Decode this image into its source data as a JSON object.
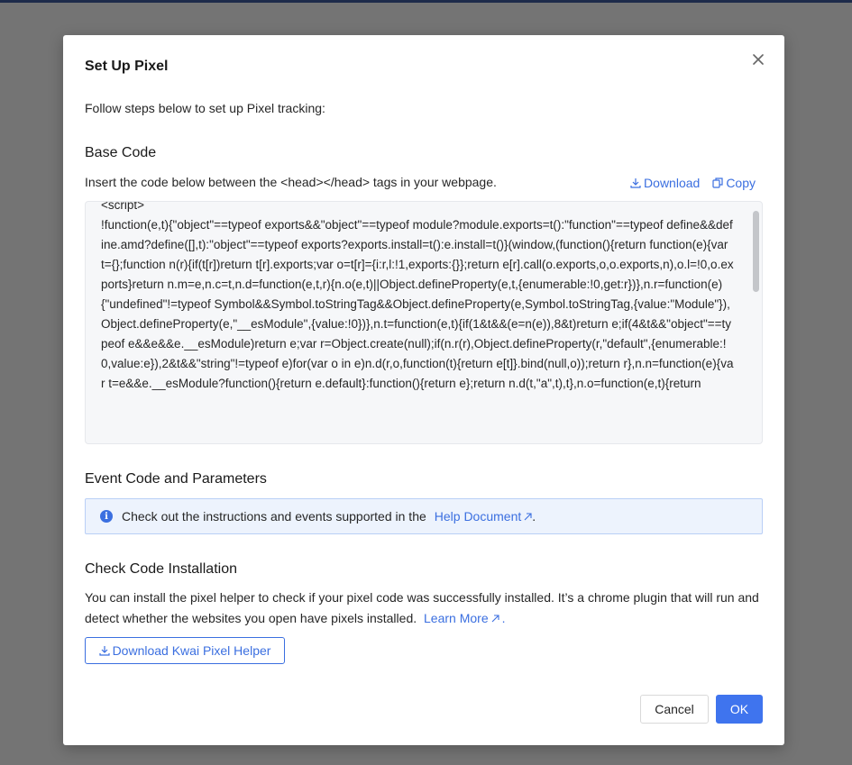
{
  "modal": {
    "title": "Set Up Pixel",
    "intro": "Follow steps below to set up Pixel tracking:"
  },
  "base_code": {
    "heading": "Base Code",
    "description": "Insert the code below between the <head></head> tags in your webpage.",
    "download_label": "Download",
    "copy_label": "Copy",
    "code": "<script>\n!function(e,t){\"object\"==typeof exports&&\"object\"==typeof module?module.exports=t():\"function\"==typeof define&&define.amd?define([],t):\"object\"==typeof exports?exports.install=t():e.install=t()}(window,(function(){return function(e){var t={};function n(r){if(t[r])return t[r].exports;var o=t[r]={i:r,l:!1,exports:{}};return e[r].call(o.exports,o,o.exports,n),o.l=!0,o.exports}return n.m=e,n.c=t,n.d=function(e,t,r){n.o(e,t)||Object.defineProperty(e,t,{enumerable:!0,get:r})},n.r=function(e){\"undefined\"!=typeof Symbol&&Symbol.toStringTag&&Object.defineProperty(e,Symbol.toStringTag,{value:\"Module\"}),Object.defineProperty(e,\"__esModule\",{value:!0})},n.t=function(e,t){if(1&t&&(e=n(e)),8&t)return e;if(4&t&&\"object\"==typeof e&&e&&e.__esModule)return e;var r=Object.create(null);if(n.r(r),Object.defineProperty(r,\"default\",{enumerable:!0,value:e}),2&t&&\"string\"!=typeof e)for(var o in e)n.d(r,o,function(t){return e[t]}.bind(null,o));return r},n.n=function(e){var t=e&&e.__esModule?function(){return e.default}:function(){return e};return n.d(t,\"a\",t),t},n.o=function(e,t){return"
  },
  "event_code": {
    "heading": "Event Code and Parameters",
    "info_text": "Check out the instructions and events supported in the",
    "help_link": "Help Document",
    "help_suffix": "."
  },
  "check_install": {
    "heading": "Check Code Installation",
    "description": "You can install the pixel helper to check if your pixel code was successfully installed. It’s a chrome plugin that will run and detect whether the websites you open have pixels installed.",
    "learn_more": "Learn More",
    "learn_more_suffix": ".",
    "helper_button": "Download Kwai Pixel Helper"
  },
  "footer": {
    "cancel_label": "Cancel",
    "ok_label": "OK"
  },
  "colors": {
    "accent": "#3f74ee",
    "link": "#3b6fe0",
    "backdrop": "#747474",
    "info_bg": "#edf3fd",
    "info_border": "#b9cff6"
  }
}
